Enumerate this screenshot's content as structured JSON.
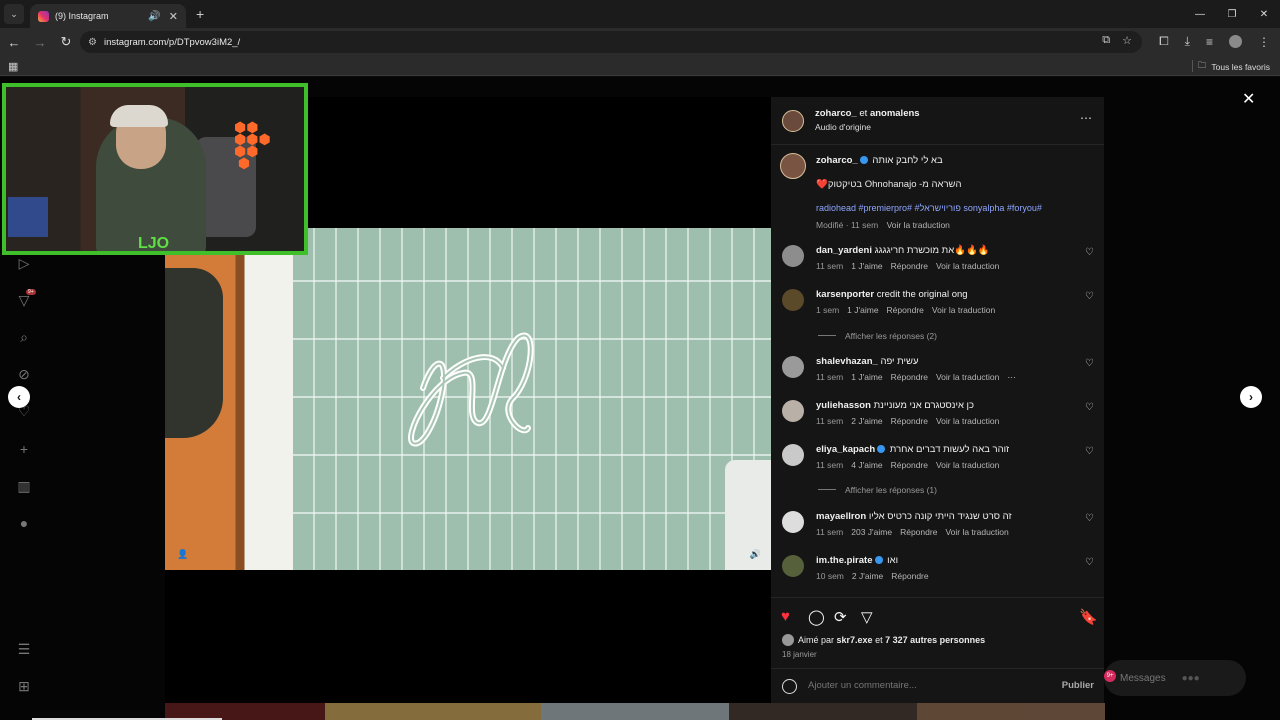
{
  "browser": {
    "tab_title": "(9) Instagram",
    "url": "instagram.com/p/DTpvow3iM2_/",
    "bookmarks_label": "Tous les favoris"
  },
  "post": {
    "header_names": "zoharco_",
    "header_et": "et",
    "header_collab": "anomalens",
    "audio": "Audio d'origine",
    "caption_user": "zoharco_",
    "caption_line1": "בא לי לחבק אותה",
    "caption_line2": "❤️בטיקטוק Ohnohanajo -השראה מ",
    "caption_tags": "radiohead #premierpro# #פוריוישראל sonyalpha #foryou#",
    "caption_meta_modified": "Modifié · 11 sem",
    "caption_meta_translate": "Voir la traduction",
    "liked_by_prefix": "Aimé par",
    "liked_by_user": "skr7.exe",
    "liked_by_et": "et",
    "liked_by_count": "7 327 autres personnes",
    "date": "18 janvier",
    "comment_placeholder": "Ajouter un commentaire...",
    "publish": "Publier"
  },
  "comments": [
    {
      "user": "dan_yardeni",
      "text": "את מוכשרת חריגגגג🔥🔥🔥",
      "time": "11 sem",
      "likes": "1 J'aime",
      "reply": "Répondre",
      "translate": "Voir la traduction"
    },
    {
      "user": "karsenporter",
      "text": "credit the original ong",
      "time": "1 sem",
      "likes": "1 J'aime",
      "reply": "Répondre",
      "translate": "Voir la traduction"
    },
    {
      "user": "shalevhazan_",
      "text": "עשית יפה",
      "time": "11 sem",
      "likes": "1 J'aime",
      "reply": "Répondre",
      "translate": "Voir la traduction"
    },
    {
      "user": "yuliehasson",
      "text": "כן אינסטגרם אני מעוניינת",
      "time": "11 sem",
      "likes": "2 J'aime",
      "reply": "Répondre",
      "translate": "Voir la traduction"
    },
    {
      "user": "eliya_kapach",
      "text": "זוהר באה לעשות דברים אחרת",
      "time": "11 sem",
      "likes": "4 J'aime",
      "reply": "Répondre",
      "translate": "Voir la traduction"
    },
    {
      "user": "mayaellron",
      "text": "זה סרט שנגיד הייתי קונה כרטיס אליו",
      "time": "11 sem",
      "likes": "203 J'aime",
      "reply": "Répondre",
      "translate": "Voir la traduction"
    },
    {
      "user": "im.the.pirate",
      "text": "ואו",
      "time": "10 sem",
      "likes": "2 J'aime",
      "reply": "Répondre",
      "translate": ""
    }
  ],
  "replies": {
    "karsen": "Afficher les réponses (2)",
    "eliya": "Afficher les réponses (1)"
  },
  "messages": {
    "label": "Messages",
    "badge": "9+"
  },
  "sidebar": {
    "notif_badge": "9+"
  },
  "webcam": {
    "tag": "LJO"
  }
}
